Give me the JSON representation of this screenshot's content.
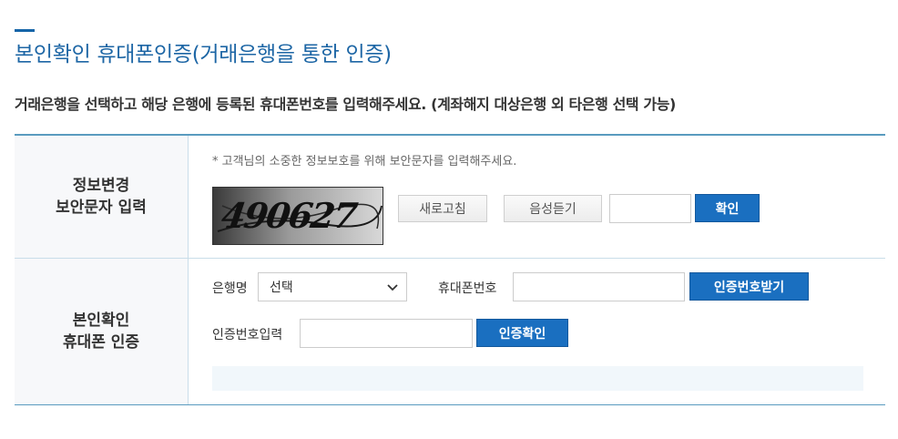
{
  "page": {
    "title": "본인확인 휴대폰인증(거래은행을 통한 인증)",
    "description": "거래은행을 선택하고 해당 은행에 등록된 휴대폰번호를 입력해주세요. (계좌해지 대상은행 외 타은행 선택 가능)"
  },
  "captcha_section": {
    "header_line1": "정보변경",
    "header_line2": "보안문자 입력",
    "note": "* 고객님의 소중한 정보보호를 위해 보안문자를 입력해주세요.",
    "captcha_text": "490627",
    "refresh_label": "새로고침",
    "audio_label": "음성듣기",
    "input_value": "",
    "confirm_label": "확인"
  },
  "auth_section": {
    "header_line1": "본인확인",
    "header_line2": "휴대폰 인증",
    "bank_label": "은행명",
    "bank_selected": "선택",
    "phone_label": "휴대폰번호",
    "phone_value": "",
    "request_code_label": "인증번호받기",
    "code_label": "인증번호입력",
    "code_value": "",
    "verify_label": "인증확인"
  },
  "colors": {
    "title": "#1d66a5",
    "button_blue": "#1a6fc0",
    "table_border": "#5a9bbf"
  }
}
